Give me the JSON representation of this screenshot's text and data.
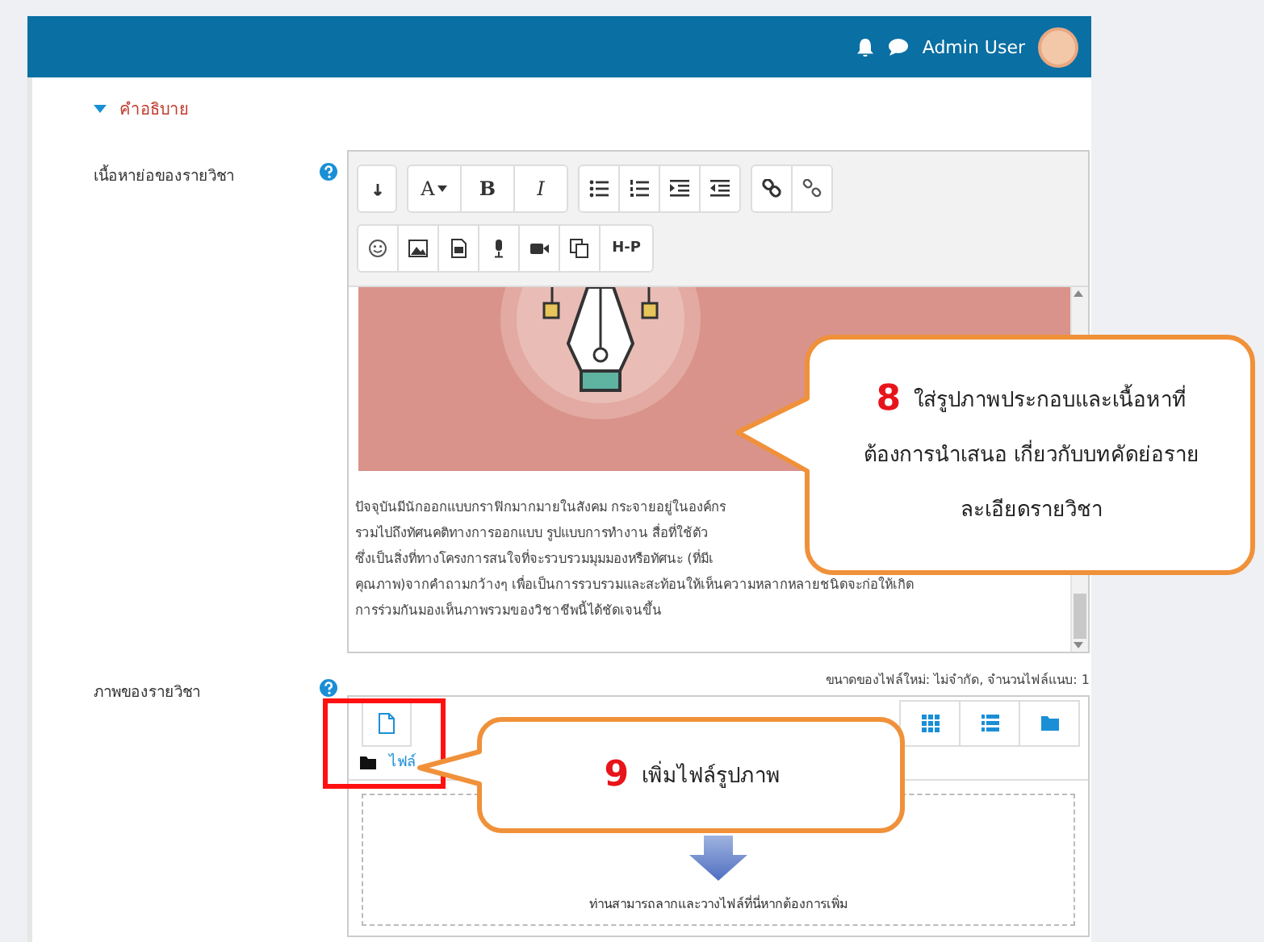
{
  "header": {
    "user_name": "Admin User"
  },
  "section": {
    "title": "คำอธิบาย",
    "expanded": true
  },
  "summary_field": {
    "label": "เนื้อหาย่อของรายวิชา",
    "toolbar": [
      [
        [
          {
            "kind": "icon"
          }
        ],
        [
          {
            "kind": "text",
            "text": "A"
          },
          {
            "kind": "text",
            "text": "B"
          },
          {
            "kind": "text",
            "text": "I"
          }
        ],
        [
          {
            "kind": "icon"
          },
          {
            "kind": "icon"
          },
          {
            "kind": "icon"
          },
          {
            "kind": "icon"
          }
        ],
        [
          {
            "kind": "icon"
          },
          {
            "kind": "icon"
          }
        ]
      ],
      [
        [
          {
            "kind": "icon"
          },
          {
            "kind": "icon"
          },
          {
            "kind": "icon"
          },
          {
            "kind": "icon"
          },
          {
            "kind": "icon"
          },
          {
            "kind": "icon"
          },
          {
            "kind": "text",
            "text": "H-P"
          }
        ]
      ]
    ],
    "paragraph_lines": [
      "ปัจจุบันมีนักออกแบบกราฟิกมากมายในสังคม กระจายอยู่ในองค์กร",
      "รวมไปถึงทัศนคติทางการออกแบบ รูปแบบการทำงาน สื่อที่ใช้ตัว",
      "ซึ่งเป็นสิ่งที่ทางโครงการสนใจที่จะรวบรวมมุมมองหรือทัศนะ (ที่มีเ",
      "คุณภาพ)จากคำถามกว้างๆ เพื่อเป็นการรวบรวมและสะท้อนให้เห็นความหลากหลายชนิดจะก่อให้เกิด",
      "การร่วมกันมองเห็นภาพรวมของวิชาชีพนี้ได้ชัดเจนขึ้น"
    ]
  },
  "image_field": {
    "label": "ภาพของรายวิชา",
    "limits": "ขนาดของไฟล์ใหม่: ไม่จำกัด, จำนวนไฟล์แนบ: 1",
    "path": "ไฟล์",
    "drop_hint": "ท่านสามารถลากและวางไฟล์ที่นี่หากต้องการเพิ่ม"
  },
  "callouts": [
    {
      "number": "8",
      "text": "ใส่รูปภาพประกอบและเนื้อหาที่ต้องการนำเสนอ เกี่ยวกับบทคัดย่อรายละเอียดรายวิชา"
    },
    {
      "number": "9",
      "text": "เพิ่มไฟล์รูปภาพ"
    }
  ]
}
